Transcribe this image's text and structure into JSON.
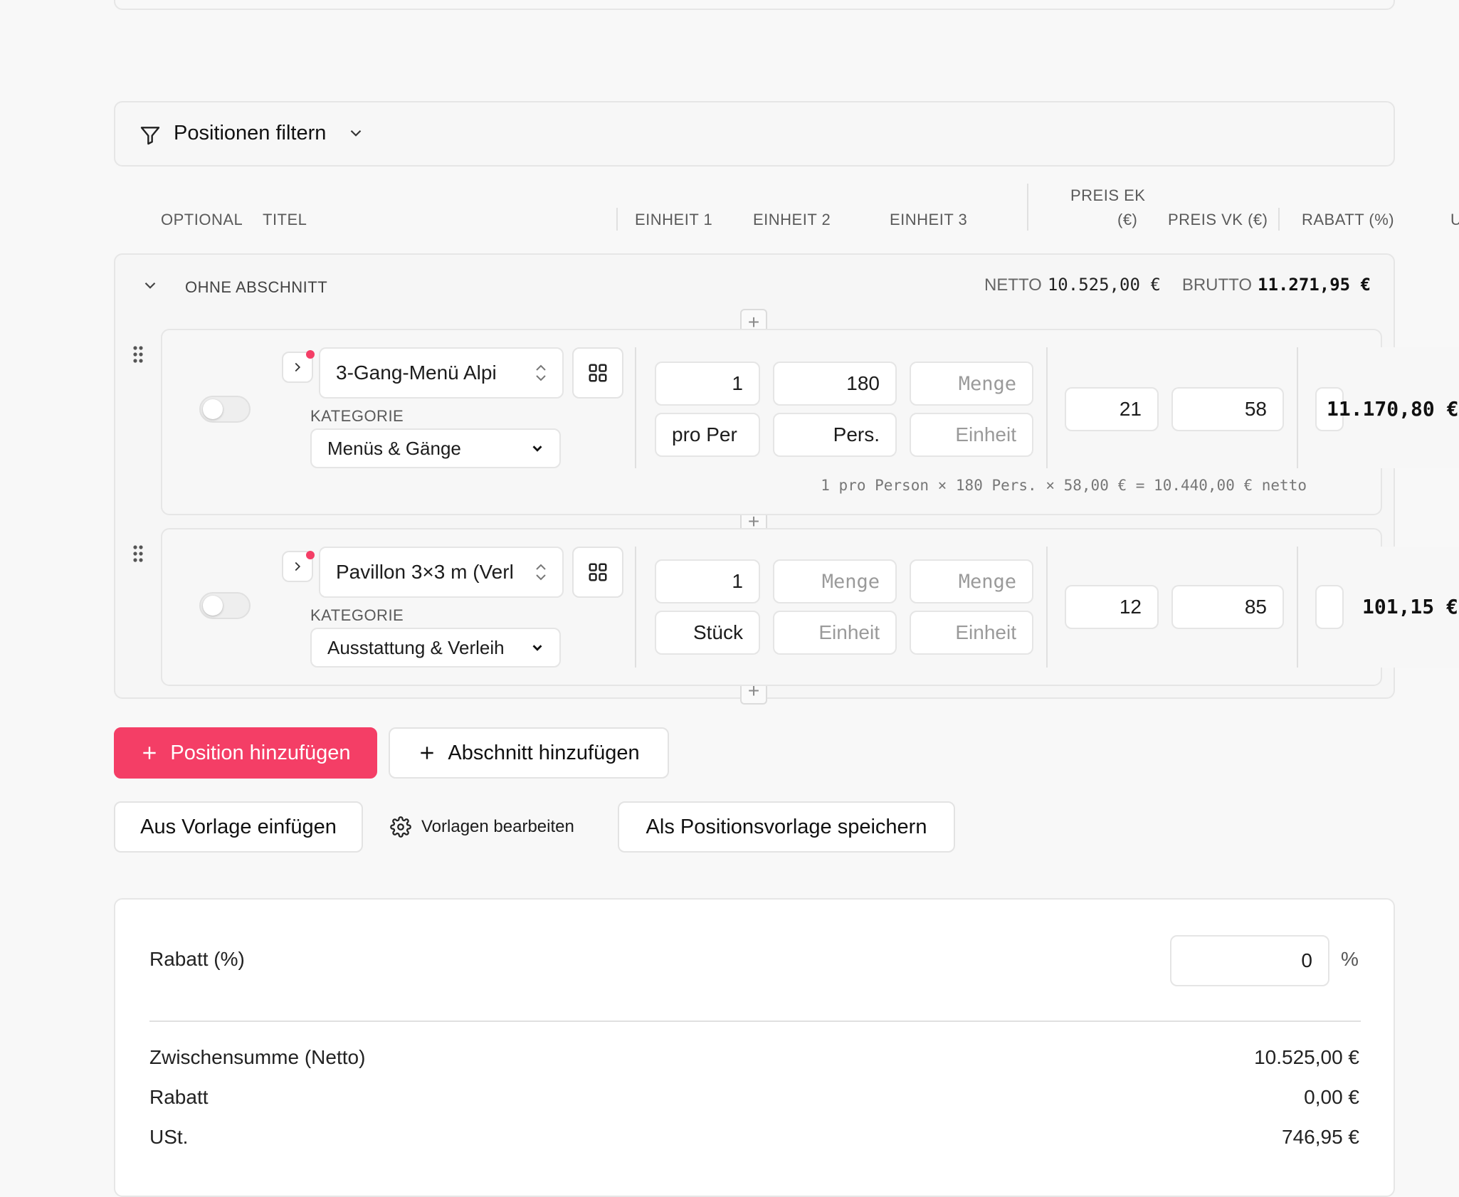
{
  "filter": {
    "label": "Positionen filtern"
  },
  "columns": {
    "optional": "OPTIONAL",
    "titel": "TITEL",
    "einheit1": "EINHEIT 1",
    "einheit2": "EINHEIT 2",
    "einheit3": "EINHEIT 3",
    "preis_ek_line1": "PREIS EK",
    "preis_ek_line2": "(€)",
    "preis_vk": "PREIS VK (€)",
    "rabatt": "RABATT (%)",
    "cut": "U"
  },
  "section": {
    "title": "OHNE ABSCHNITT",
    "netto_label": "NETTO",
    "netto_value": "10.525,00 €",
    "brutto_label": "BRUTTO",
    "brutto_value": "11.271,95 €"
  },
  "positions": [
    {
      "title": "3-Gang-Menü Alpi",
      "category_label": "KATEGORIE",
      "category": "Menüs & Gänge",
      "qty1": "1",
      "qty2": "180",
      "qty3_placeholder": "Menge",
      "unit1": "pro Per",
      "unit2": "Pers.",
      "unit3_placeholder": "Einheit",
      "preis_ek": "21",
      "preis_vk": "58",
      "total": "11.170,80 €",
      "formula": "1 pro Person × 180 Pers. × 58,00 € = 10.440,00 € netto",
      "optional": false
    },
    {
      "title": "Pavillon 3×3 m (Verl",
      "category_label": "KATEGORIE",
      "category": "Ausstattung & Verleih",
      "qty1": "1",
      "qty2_placeholder": "Menge",
      "qty3_placeholder": "Menge",
      "unit1": "Stück",
      "unit2_placeholder": "Einheit",
      "unit3_placeholder": "Einheit",
      "preis_ek": "12",
      "preis_vk": "85",
      "total": "101,15 €",
      "optional": false
    }
  ],
  "actions": {
    "add_position": "Position hinzufügen",
    "add_section": "Abschnitt hinzufügen",
    "insert_template": "Aus Vorlage einfügen",
    "edit_templates": "Vorlagen bearbeiten",
    "save_template": "Als Positionsvorlage speichern"
  },
  "summary": {
    "rabatt_label": "Rabatt (%)",
    "rabatt_value": "0",
    "percent": "%",
    "rows": [
      {
        "label": "Zwischensumme (Netto)",
        "value": "10.525,00 €"
      },
      {
        "label": "Rabatt",
        "value": "0,00 €"
      },
      {
        "label": "USt.",
        "value": "746,95 €"
      }
    ]
  },
  "colors": {
    "accent": "#f43e66",
    "border": "#e5e5e5",
    "background": "#f8f8f8"
  }
}
